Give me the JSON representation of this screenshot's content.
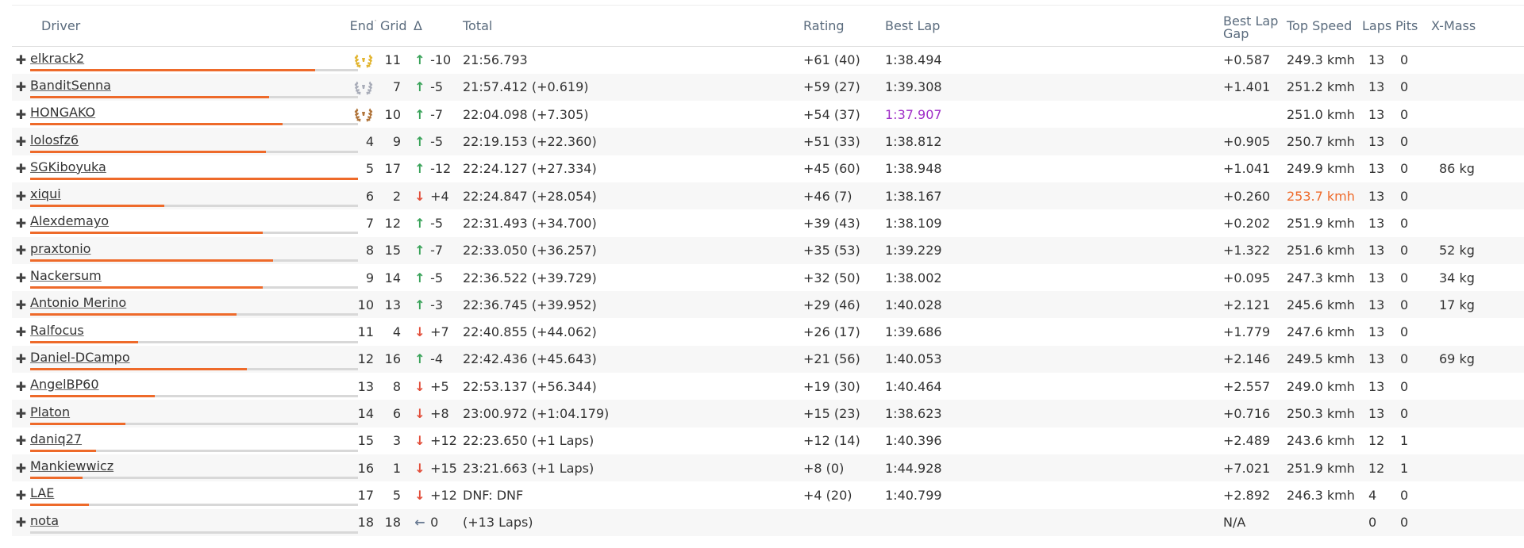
{
  "headers": {
    "driver": "Driver",
    "end": "End",
    "grid": "Grid",
    "delta": "Δ",
    "total": "Total",
    "rating": "Rating",
    "best_lap": "Best Lap",
    "best_lap_gap_1": "Best Lap",
    "best_lap_gap_2": "Gap",
    "top_speed": "Top Speed",
    "laps": "Laps",
    "pits": "Pits",
    "x_mass": "X-Mass"
  },
  "colors": {
    "accent_bar": "#ee6a2a",
    "bar_track": "#d8d8d8",
    "up_arrow": "#3aa35a",
    "down_arrow": "#e24f3b",
    "neutral_arrow": "#6b7c94",
    "fastest_lap": "#a02fc8",
    "top_speed_best": "#ee6a2a",
    "gold": "#e2b531",
    "silver": "#a8acb8",
    "bronze": "#b0743a"
  },
  "rows": [
    {
      "name": "elkrack2",
      "progress": 0.87,
      "end": "",
      "medal": "gold",
      "grid": "11",
      "dir": "up",
      "delta": "-10",
      "total": "21:56.793",
      "rating": "+61 (40)",
      "best_lap": "1:38.494",
      "best_lap_class": "",
      "gap": "+0.587",
      "speed": "249.3 kmh",
      "speed_class": "",
      "laps": "13",
      "pits": "0",
      "mass": ""
    },
    {
      "name": "BanditSenna",
      "progress": 0.73,
      "end": "",
      "medal": "silver",
      "grid": "7",
      "dir": "up",
      "delta": "-5",
      "total": "21:57.412 (+0.619)",
      "rating": "+59 (27)",
      "best_lap": "1:39.308",
      "best_lap_class": "",
      "gap": "+1.401",
      "speed": "251.2 kmh",
      "speed_class": "",
      "laps": "13",
      "pits": "0",
      "mass": ""
    },
    {
      "name": "HONGAKO",
      "progress": 0.77,
      "end": "",
      "medal": "bronze",
      "grid": "10",
      "dir": "up",
      "delta": "-7",
      "total": "22:04.098 (+7.305)",
      "rating": "+54 (37)",
      "best_lap": "1:37.907",
      "best_lap_class": "purple",
      "gap": "",
      "speed": "251.0 kmh",
      "speed_class": "",
      "laps": "13",
      "pits": "0",
      "mass": ""
    },
    {
      "name": "lolosfz6",
      "progress": 0.72,
      "end": "4",
      "medal": "",
      "grid": "9",
      "dir": "up",
      "delta": "-5",
      "total": "22:19.153 (+22.360)",
      "rating": "+51 (33)",
      "best_lap": "1:38.812",
      "best_lap_class": "",
      "gap": "+0.905",
      "speed": "250.7 kmh",
      "speed_class": "",
      "laps": "13",
      "pits": "0",
      "mass": ""
    },
    {
      "name": "SGKiboyuka",
      "progress": 1.0,
      "end": "5",
      "medal": "",
      "grid": "17",
      "dir": "up",
      "delta": "-12",
      "total": "22:24.127 (+27.334)",
      "rating": "+45 (60)",
      "best_lap": "1:38.948",
      "best_lap_class": "",
      "gap": "+1.041",
      "speed": "249.9 kmh",
      "speed_class": "",
      "laps": "13",
      "pits": "0",
      "mass": "86 kg"
    },
    {
      "name": "xiqui",
      "progress": 0.41,
      "end": "6",
      "medal": "",
      "grid": "2",
      "dir": "down",
      "delta": "+4",
      "total": "22:24.847 (+28.054)",
      "rating": "+46 (7)",
      "best_lap": "1:38.167",
      "best_lap_class": "",
      "gap": "+0.260",
      "speed": "253.7 kmh",
      "speed_class": "orange",
      "laps": "13",
      "pits": "0",
      "mass": ""
    },
    {
      "name": "Alexdemayo",
      "progress": 0.71,
      "end": "7",
      "medal": "",
      "grid": "12",
      "dir": "up",
      "delta": "-5",
      "total": "22:31.493 (+34.700)",
      "rating": "+39 (43)",
      "best_lap": "1:38.109",
      "best_lap_class": "",
      "gap": "+0.202",
      "speed": "251.9 kmh",
      "speed_class": "",
      "laps": "13",
      "pits": "0",
      "mass": ""
    },
    {
      "name": "praxtonio",
      "progress": 0.74,
      "end": "8",
      "medal": "",
      "grid": "15",
      "dir": "up",
      "delta": "-7",
      "total": "22:33.050 (+36.257)",
      "rating": "+35 (53)",
      "best_lap": "1:39.229",
      "best_lap_class": "",
      "gap": "+1.322",
      "speed": "251.6 kmh",
      "speed_class": "",
      "laps": "13",
      "pits": "0",
      "mass": "52 kg"
    },
    {
      "name": "Nackersum",
      "progress": 0.71,
      "end": "9",
      "medal": "",
      "grid": "14",
      "dir": "up",
      "delta": "-5",
      "total": "22:36.522 (+39.729)",
      "rating": "+32 (50)",
      "best_lap": "1:38.002",
      "best_lap_class": "",
      "gap": "+0.095",
      "speed": "247.3 kmh",
      "speed_class": "",
      "laps": "13",
      "pits": "0",
      "mass": "34 kg"
    },
    {
      "name": "Antonio Merino",
      "progress": 0.63,
      "end": "10",
      "medal": "",
      "grid": "13",
      "dir": "up",
      "delta": "-3",
      "total": "22:36.745 (+39.952)",
      "rating": "+29 (46)",
      "best_lap": "1:40.028",
      "best_lap_class": "",
      "gap": "+2.121",
      "speed": "245.6 kmh",
      "speed_class": "",
      "laps": "13",
      "pits": "0",
      "mass": "17 kg"
    },
    {
      "name": "Ralfocus",
      "progress": 0.33,
      "end": "11",
      "medal": "",
      "grid": "4",
      "dir": "down",
      "delta": "+7",
      "total": "22:40.855 (+44.062)",
      "rating": "+26 (17)",
      "best_lap": "1:39.686",
      "best_lap_class": "",
      "gap": "+1.779",
      "speed": "247.6 kmh",
      "speed_class": "",
      "laps": "13",
      "pits": "0",
      "mass": ""
    },
    {
      "name": "Daniel-DCampo",
      "progress": 0.66,
      "end": "12",
      "medal": "",
      "grid": "16",
      "dir": "up",
      "delta": "-4",
      "total": "22:42.436 (+45.643)",
      "rating": "+21 (56)",
      "best_lap": "1:40.053",
      "best_lap_class": "",
      "gap": "+2.146",
      "speed": "249.5 kmh",
      "speed_class": "",
      "laps": "13",
      "pits": "0",
      "mass": "69 kg"
    },
    {
      "name": "AngelBP60",
      "progress": 0.38,
      "end": "13",
      "medal": "",
      "grid": "8",
      "dir": "down",
      "delta": "+5",
      "total": "22:53.137 (+56.344)",
      "rating": "+19 (30)",
      "best_lap": "1:40.464",
      "best_lap_class": "",
      "gap": "+2.557",
      "speed": "249.0 kmh",
      "speed_class": "",
      "laps": "13",
      "pits": "0",
      "mass": ""
    },
    {
      "name": "Platon",
      "progress": 0.29,
      "end": "14",
      "medal": "",
      "grid": "6",
      "dir": "down",
      "delta": "+8",
      "total": "23:00.972 (+1:04.179)",
      "rating": "+15 (23)",
      "best_lap": "1:38.623",
      "best_lap_class": "",
      "gap": "+0.716",
      "speed": "250.3 kmh",
      "speed_class": "",
      "laps": "13",
      "pits": "0",
      "mass": ""
    },
    {
      "name": "daniq27",
      "progress": 0.2,
      "end": "15",
      "medal": "",
      "grid": "3",
      "dir": "down",
      "delta": "+12",
      "total": "22:23.650 (+1 Laps)",
      "rating": "+12 (14)",
      "best_lap": "1:40.396",
      "best_lap_class": "",
      "gap": "+2.489",
      "speed": "243.6 kmh",
      "speed_class": "",
      "laps": "12",
      "pits": "1",
      "mass": ""
    },
    {
      "name": "Mankiewwicz",
      "progress": 0.16,
      "end": "16",
      "medal": "",
      "grid": "1",
      "dir": "down",
      "delta": "+15",
      "total": "23:21.663 (+1 Laps)",
      "rating": "+8 (0)",
      "best_lap": "1:44.928",
      "best_lap_class": "",
      "gap": "+7.021",
      "speed": "251.9 kmh",
      "speed_class": "",
      "laps": "12",
      "pits": "1",
      "mass": ""
    },
    {
      "name": "LAE",
      "progress": 0.18,
      "end": "17",
      "medal": "",
      "grid": "5",
      "dir": "down",
      "delta": "+12",
      "total": "DNF: DNF",
      "rating": "+4 (20)",
      "best_lap": "1:40.799",
      "best_lap_class": "",
      "gap": "+2.892",
      "speed": "246.3 kmh",
      "speed_class": "",
      "laps": "4",
      "pits": "0",
      "mass": ""
    },
    {
      "name": "nota",
      "progress": 0.0,
      "end": "18",
      "medal": "",
      "grid": "18",
      "dir": "flat",
      "delta": "0",
      "total": "(+13 Laps)",
      "rating": "",
      "best_lap": "",
      "best_lap_class": "",
      "gap": "N/A",
      "speed": "",
      "speed_class": "",
      "laps": "0",
      "pits": "0",
      "mass": ""
    }
  ]
}
